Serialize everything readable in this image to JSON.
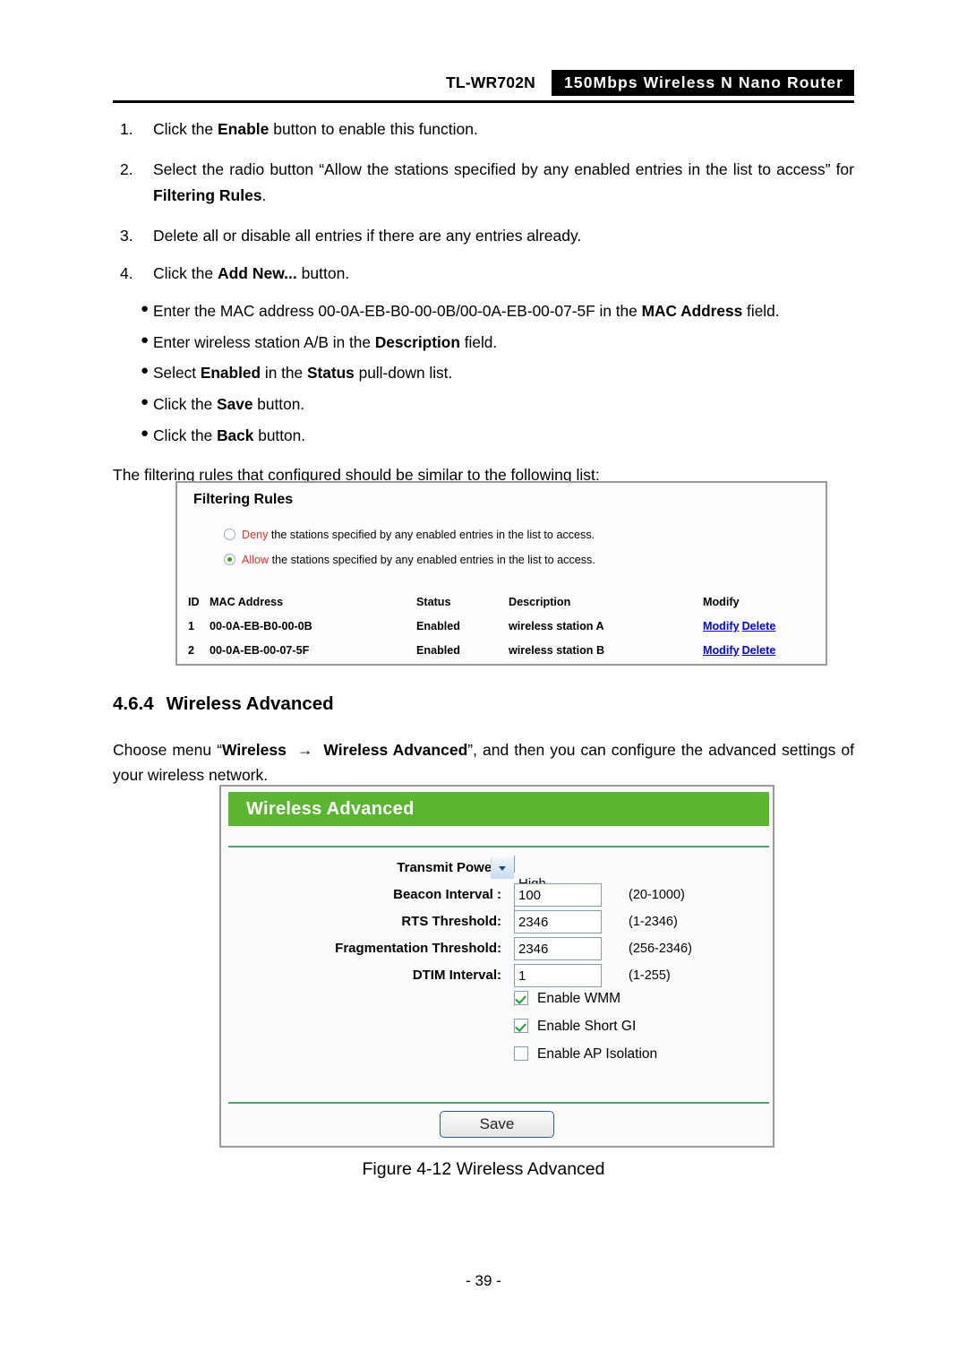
{
  "header": {
    "model": "TL-WR702N",
    "banner": "150Mbps  Wireless  N  Nano  Router"
  },
  "steps": [
    {
      "num": "1.",
      "html": "Click the <b>Enable</b> button to enable this function."
    },
    {
      "num": "2.",
      "html": "Select the radio button &ldquo;Allow the stations specified by any enabled entries in the list to access&rdquo; for <b>Filtering Rules</b>."
    },
    {
      "num": "3.",
      "html": "Delete all or disable all entries if there are any entries already."
    },
    {
      "num": "4.",
      "html": "Click the <b>Add New...</b> button."
    }
  ],
  "bullets": [
    {
      "html": "Enter the MAC address 00-0A-EB-B0-00-0B/00-0A-EB-00-07-5F in the <b>MAC Address</b> field."
    },
    {
      "html": "Enter wireless station A/B in the <b>Description</b> field."
    },
    {
      "html": "Select <b>Enabled</b> in the <b>Status</b> pull-down list."
    },
    {
      "html": "Click the <b>Save</b> button."
    },
    {
      "html": "Click the <b>Back</b> button."
    }
  ],
  "intro_paragraph": "The filtering rules that configured should be similar to the following list:",
  "filtering_rules": {
    "title": "Filtering Rules",
    "radios": [
      {
        "word": "Deny",
        "rest": " the stations specified by any enabled entries in the list to access.",
        "selected": false
      },
      {
        "word": "Allow",
        "rest": " the stations specified by any enabled entries in the list to access.",
        "selected": true
      }
    ],
    "columns": [
      "ID",
      "MAC Address",
      "Status",
      "Description",
      "Modify"
    ],
    "rows": [
      {
        "id": "1",
        "mac": "00-0A-EB-B0-00-0B",
        "status": "Enabled",
        "description": "wireless station A",
        "modify": "Modify",
        "delete": "Delete"
      },
      {
        "id": "2",
        "mac": "00-0A-EB-00-07-5F",
        "status": "Enabled",
        "description": "wireless station B",
        "modify": "Modify",
        "delete": "Delete"
      }
    ],
    "link_color": "#0000ee",
    "word_color": "#e23127"
  },
  "section": {
    "number": "4.6.4",
    "title": "Wireless Advanced",
    "paragraph_html": "Choose menu &ldquo;<b>Wireless &nbsp;&rarr;&nbsp; Wireless Advanced</b>&rdquo;, and then you can configure the advanced settings of your wireless network."
  },
  "wireless_advanced": {
    "panel_title": "Wireless Advanced",
    "accent_green": "#5cb531",
    "divider_green": "#4f9f6d",
    "fields": [
      {
        "label": "Transmit Power:",
        "type": "select",
        "value": "High",
        "hint": ""
      },
      {
        "label": "Beacon Interval :",
        "type": "text",
        "value": "100",
        "hint": "(20-1000)"
      },
      {
        "label": "RTS Threshold:",
        "type": "text",
        "value": "2346",
        "hint": "(1-2346)"
      },
      {
        "label": "Fragmentation Threshold:",
        "type": "text",
        "value": "2346",
        "hint": "(256-2346)"
      },
      {
        "label": "DTIM Interval:",
        "type": "text",
        "value": "1",
        "hint": "(1-255)"
      }
    ],
    "checkboxes": [
      {
        "label": "Enable WMM",
        "checked": true
      },
      {
        "label": "Enable Short GI",
        "checked": true
      },
      {
        "label": "Enable AP Isolation",
        "checked": false
      }
    ],
    "save_label": "Save"
  },
  "figure_caption": "Figure 4-12 Wireless Advanced",
  "page_number": "- 39 -"
}
